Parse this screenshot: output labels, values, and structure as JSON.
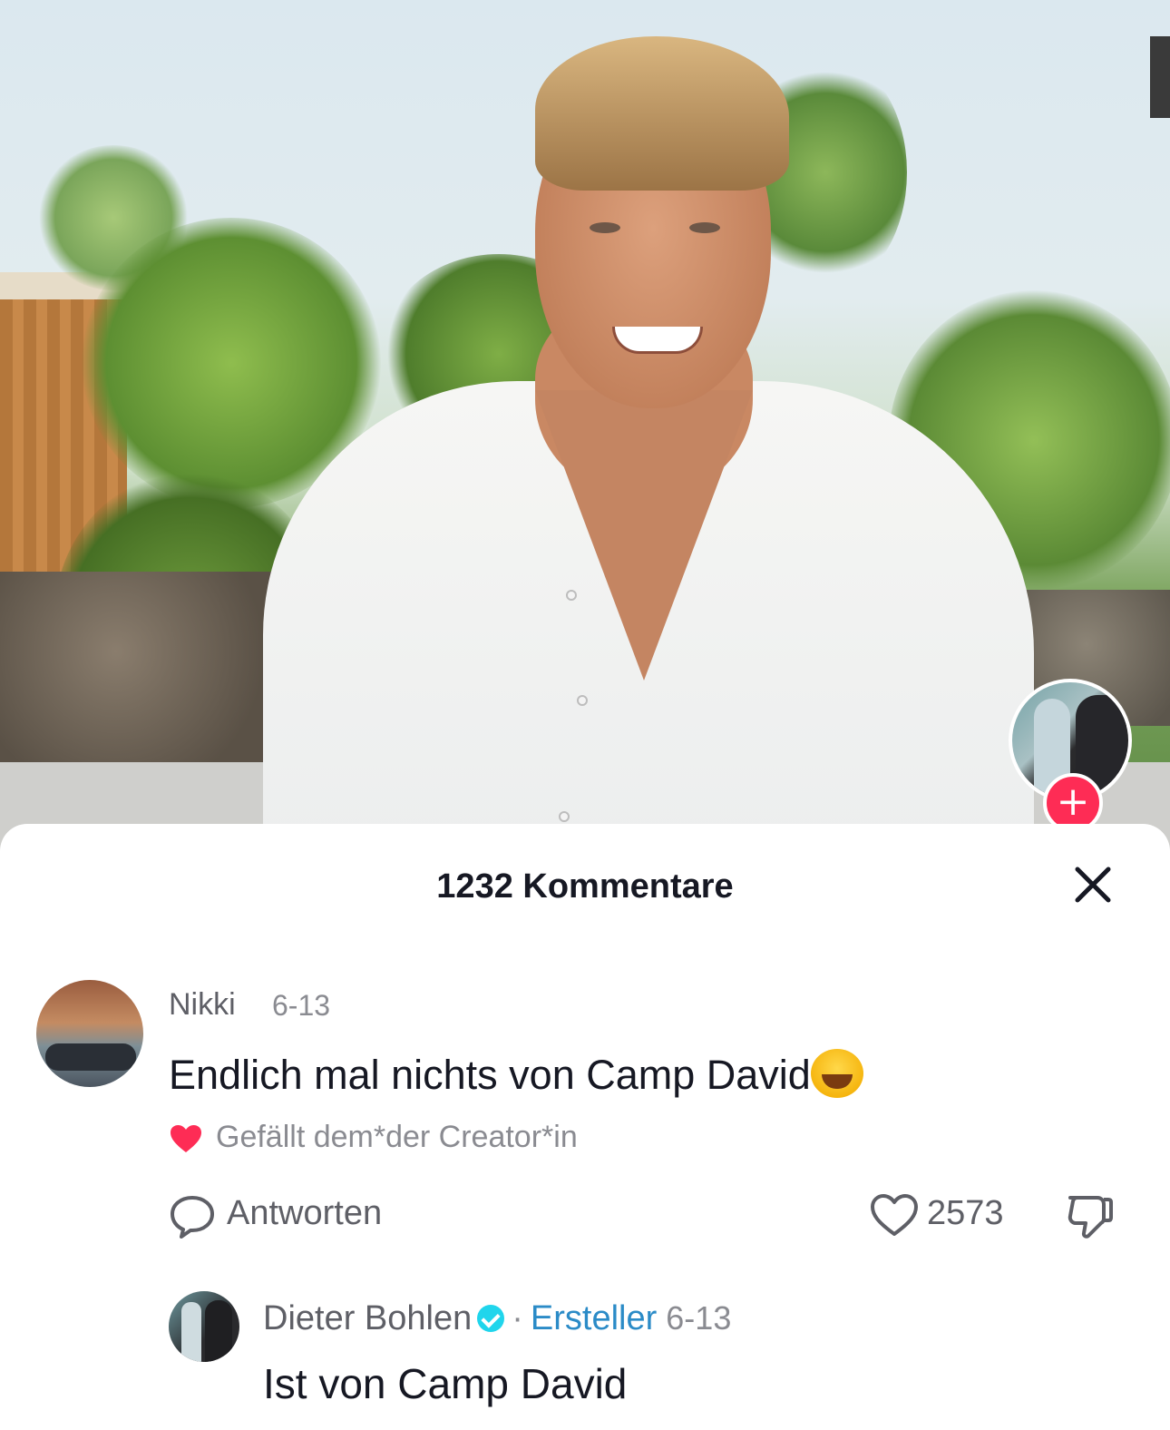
{
  "video": {
    "creator_avatar_icon": "creator-avatar",
    "follow_icon": "plus",
    "follow_color": "#fe2c55"
  },
  "comments_sheet": {
    "title": "1232 Kommentare",
    "close_icon": "close-x"
  },
  "comment": {
    "username": "Nikki",
    "date": "6-13",
    "text": "Endlich mal nichts von Camp David",
    "emoji": "laughing-with-tears",
    "liked_by_creator": "Gefällt dem*der Creator*in",
    "liked_heart_color": "#fe2c55",
    "reply_label": "Antworten",
    "like_count": "2573"
  },
  "reply": {
    "username": "Dieter Bohlen",
    "verified": true,
    "separator": "·",
    "badge": "Ersteller",
    "date": "6-13",
    "text": "Ist von Camp David"
  }
}
